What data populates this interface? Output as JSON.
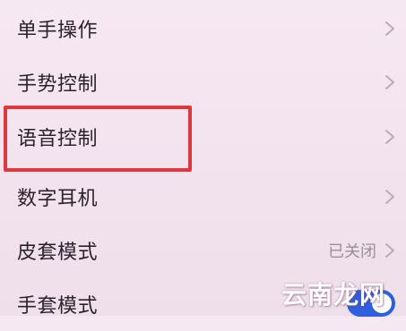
{
  "settings": {
    "items": [
      {
        "label": "单手操作",
        "trailing": "chevron"
      },
      {
        "label": "手势控制",
        "trailing": "chevron"
      },
      {
        "label": "语音控制",
        "trailing": "chevron",
        "highlighted": true
      },
      {
        "label": "数字耳机",
        "trailing": "chevron"
      },
      {
        "label": "皮套模式",
        "trailing": "chevron",
        "status": "已关闭"
      },
      {
        "label": "手套模式",
        "trailing": "toggle",
        "toggle_on": true
      }
    ]
  },
  "watermark": {
    "text": "云南龙网"
  },
  "colors": {
    "background": "#f3e3ef",
    "text": "#2b2230",
    "chevron": "#b8acb8",
    "status_text": "#9a8f9c",
    "highlight_border": "#e0373c",
    "toggle_on": "#2d5fe0"
  },
  "icons": {
    "chevron": "chevron-right-icon"
  }
}
